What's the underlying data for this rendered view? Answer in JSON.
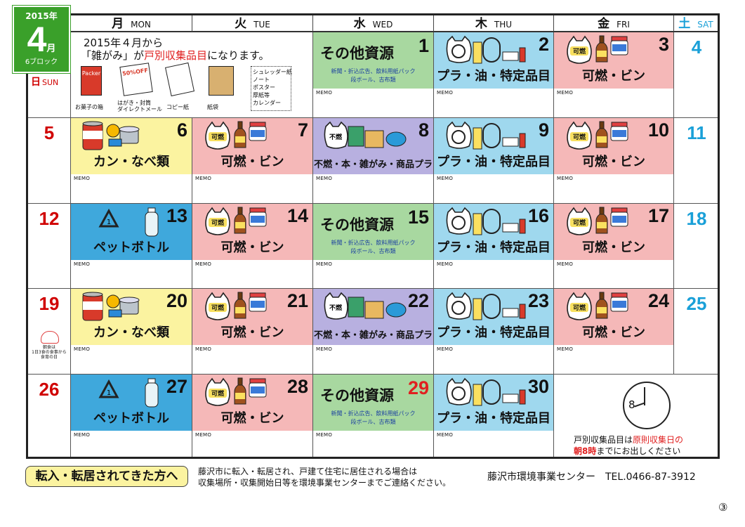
{
  "title_box": {
    "year": "2015年",
    "month": "4",
    "month_suffix": "月",
    "block": "6ブロック"
  },
  "weekdays": [
    {
      "jp": "日",
      "en": "SUN",
      "color": "#d00000"
    },
    {
      "jp": "月",
      "en": "MON",
      "color": "#111"
    },
    {
      "jp": "火",
      "en": "TUE",
      "color": "#111"
    },
    {
      "jp": "水",
      "en": "WED",
      "color": "#111"
    },
    {
      "jp": "木",
      "en": "THU",
      "color": "#111"
    },
    {
      "jp": "金",
      "en": "FRI",
      "color": "#111"
    },
    {
      "jp": "土",
      "en": "SAT",
      "color": "#1aa0d8"
    }
  ],
  "notice": {
    "line1": "2015年４月から",
    "line2_pre": "「雑がみ」が",
    "line2_red": "戸別収集品目",
    "line2_post": "になります。",
    "items": [
      "お菓子の箱",
      "はがき・封筒\nダイレクトメール",
      "コピー紙",
      "紙袋"
    ],
    "box_items": [
      "シュレッダー紙",
      "ノート",
      "ポスター",
      "厚紙等",
      "カレンダー"
    ],
    "packer": "Packer",
    "off": "50%OFF"
  },
  "categories": {
    "shigen": {
      "label": "その他資源",
      "sub1": "新聞・折込広告、飲料用紙パック",
      "sub2": "段ボール、古布類",
      "color": "#a8d8a0"
    },
    "pura": {
      "label": "プラ・油・特定品目",
      "color": "#9fd8ee"
    },
    "kanen": {
      "label": "可燃・ビン",
      "color": "#f5b8b8",
      "tag": "可燃"
    },
    "kan": {
      "label": "カン・なべ類",
      "color": "#fbf3a0"
    },
    "funen": {
      "label": "不燃・本・雑がみ・商品プラ",
      "color": "#b8b0e0",
      "tag": "不燃"
    },
    "pet": {
      "label": "ペットボトル",
      "color": "#3fa8dc"
    }
  },
  "memo": "MEMO",
  "weeks": [
    [
      {
        "d": "",
        "c": "sun"
      },
      {
        "d": "",
        "c": "notice"
      },
      {
        "d": "1",
        "c": "shigen"
      },
      {
        "d": "2",
        "c": "pura"
      },
      {
        "d": "3",
        "c": "kanen"
      },
      {
        "d": "4",
        "c": "sat"
      }
    ],
    [
      {
        "d": "5",
        "c": "sun"
      },
      {
        "d": "6",
        "c": "kan"
      },
      {
        "d": "7",
        "c": "kanen"
      },
      {
        "d": "8",
        "c": "funen"
      },
      {
        "d": "9",
        "c": "pura"
      },
      {
        "d": "10",
        "c": "kanen"
      },
      {
        "d": "11",
        "c": "sat"
      }
    ],
    [
      {
        "d": "12",
        "c": "sun"
      },
      {
        "d": "13",
        "c": "pet"
      },
      {
        "d": "14",
        "c": "kanen"
      },
      {
        "d": "15",
        "c": "shigen"
      },
      {
        "d": "16",
        "c": "pura"
      },
      {
        "d": "17",
        "c": "kanen"
      },
      {
        "d": "18",
        "c": "sat"
      }
    ],
    [
      {
        "d": "19",
        "c": "sun"
      },
      {
        "d": "20",
        "c": "kan"
      },
      {
        "d": "21",
        "c": "kanen"
      },
      {
        "d": "22",
        "c": "funen"
      },
      {
        "d": "23",
        "c": "pura"
      },
      {
        "d": "24",
        "c": "kanen"
      },
      {
        "d": "25",
        "c": "sat"
      }
    ],
    [
      {
        "d": "26",
        "c": "sun"
      },
      {
        "d": "27",
        "c": "pet"
      },
      {
        "d": "28",
        "c": "kanen"
      },
      {
        "d": "29",
        "c": "shigen",
        "red": true
      },
      {
        "d": "30",
        "c": "pura"
      },
      {
        "d": "",
        "c": "clock"
      }
    ]
  ],
  "sun19_note": "朝食は\n1日3食の食事から\n食育の日",
  "clock": {
    "num": "8",
    "line1_pre": "戸別収集品目は",
    "line1_red": "原則収集日の",
    "line2_red": "朝8時",
    "line2_post": "までにお出しください"
  },
  "footer": {
    "button": "転入・転居されてきた方へ",
    "text1": "藤沢市に転入・転居され、戸建て住宅に居住される場合は",
    "text2": "収集場所・収集開始日等を環境事業センターまでご連絡ください。",
    "contact": "藤沢市環境事業センター　TEL.0466-87-3912"
  },
  "page_number": "③"
}
